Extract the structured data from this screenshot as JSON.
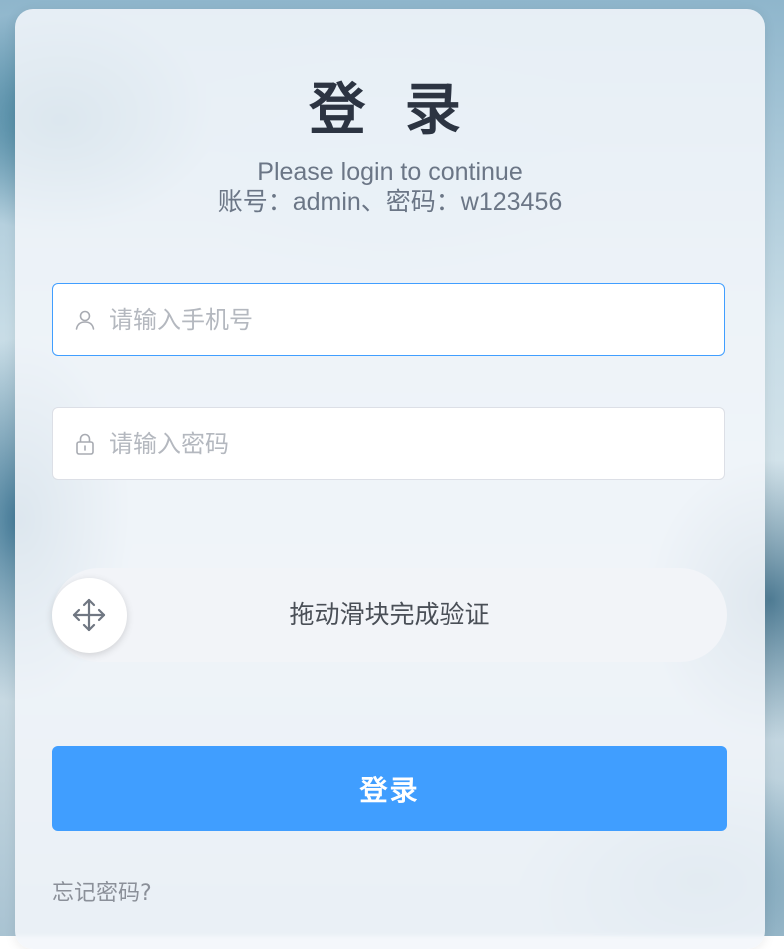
{
  "form": {
    "title": "登 录",
    "subtitle": "Please login to continue",
    "hint": "账号：admin、密码：w123456",
    "phone_placeholder": "请输入手机号",
    "phone_value": "",
    "password_placeholder": "请输入密码",
    "password_value": "",
    "slider_text": "拖动滑块完成验证",
    "login_label": "登录",
    "forgot_label": "忘记密码?"
  },
  "icons": {
    "phone": "user-icon",
    "password": "lock-icon",
    "slider": "move-arrows-icon"
  },
  "colors": {
    "accent": "#409eff",
    "title": "#2c3442",
    "muted": "#6b7686"
  }
}
